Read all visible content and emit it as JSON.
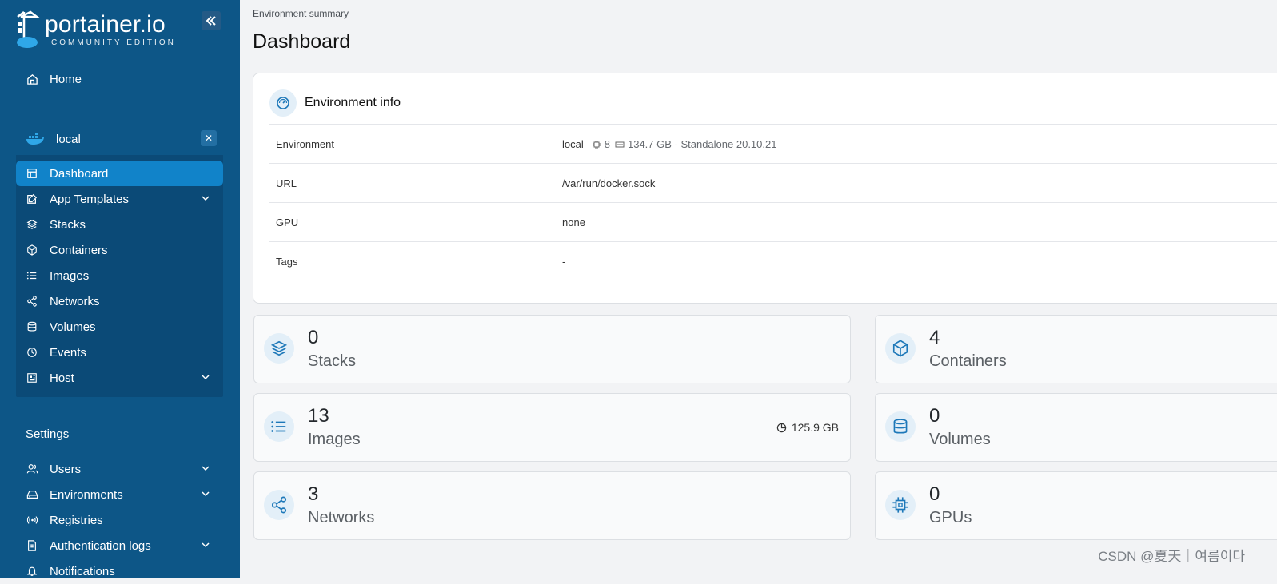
{
  "brand": {
    "name": "portainer.io",
    "edition": "COMMUNITY EDITION"
  },
  "sidebar": {
    "home": "Home",
    "environment": {
      "name": "local"
    },
    "env_items": [
      {
        "label": "Dashboard",
        "icon": "dashboard-icon",
        "active": true
      },
      {
        "label": "App Templates",
        "icon": "edit-icon",
        "expandable": true
      },
      {
        "label": "Stacks",
        "icon": "layers-icon"
      },
      {
        "label": "Containers",
        "icon": "box-icon"
      },
      {
        "label": "Images",
        "icon": "list-icon"
      },
      {
        "label": "Networks",
        "icon": "share-icon"
      },
      {
        "label": "Volumes",
        "icon": "database-icon"
      },
      {
        "label": "Events",
        "icon": "clock-icon"
      },
      {
        "label": "Host",
        "icon": "host-icon",
        "expandable": true
      }
    ],
    "settings_label": "Settings",
    "settings_items": [
      {
        "label": "Users",
        "icon": "users-icon",
        "expandable": true
      },
      {
        "label": "Environments",
        "icon": "hard-drive-icon",
        "expandable": true
      },
      {
        "label": "Registries",
        "icon": "radio-icon"
      },
      {
        "label": "Authentication logs",
        "icon": "file-icon",
        "expandable": true
      },
      {
        "label": "Notifications",
        "icon": "bell-icon"
      }
    ]
  },
  "main": {
    "breadcrumb": "Environment summary",
    "title": "Dashboard",
    "info": {
      "title": "Environment info",
      "rows": [
        {
          "key": "Environment",
          "value": "local",
          "cpu": "8",
          "memory": "134.7 GB - Standalone 20.10.21"
        },
        {
          "key": "URL",
          "value": "/var/run/docker.sock"
        },
        {
          "key": "GPU",
          "value": "none"
        },
        {
          "key": "Tags",
          "value": "-"
        }
      ]
    },
    "tiles": [
      {
        "count": "0",
        "label": "Stacks",
        "icon": "layers-icon"
      },
      {
        "count": "4",
        "label": "Containers",
        "icon": "box-icon"
      },
      {
        "count": "13",
        "label": "Images",
        "icon": "list-icon",
        "extra": "125.9 GB"
      },
      {
        "count": "0",
        "label": "Volumes",
        "icon": "database-icon"
      },
      {
        "count": "3",
        "label": "Networks",
        "icon": "share-icon"
      },
      {
        "count": "0",
        "label": "GPUs",
        "icon": "cpu-icon"
      }
    ]
  },
  "watermark": "CSDN @夏天｜여름이다",
  "colors": {
    "sidebar": "#0d5687",
    "active": "#1183c9",
    "accent": "#1d78b9"
  }
}
